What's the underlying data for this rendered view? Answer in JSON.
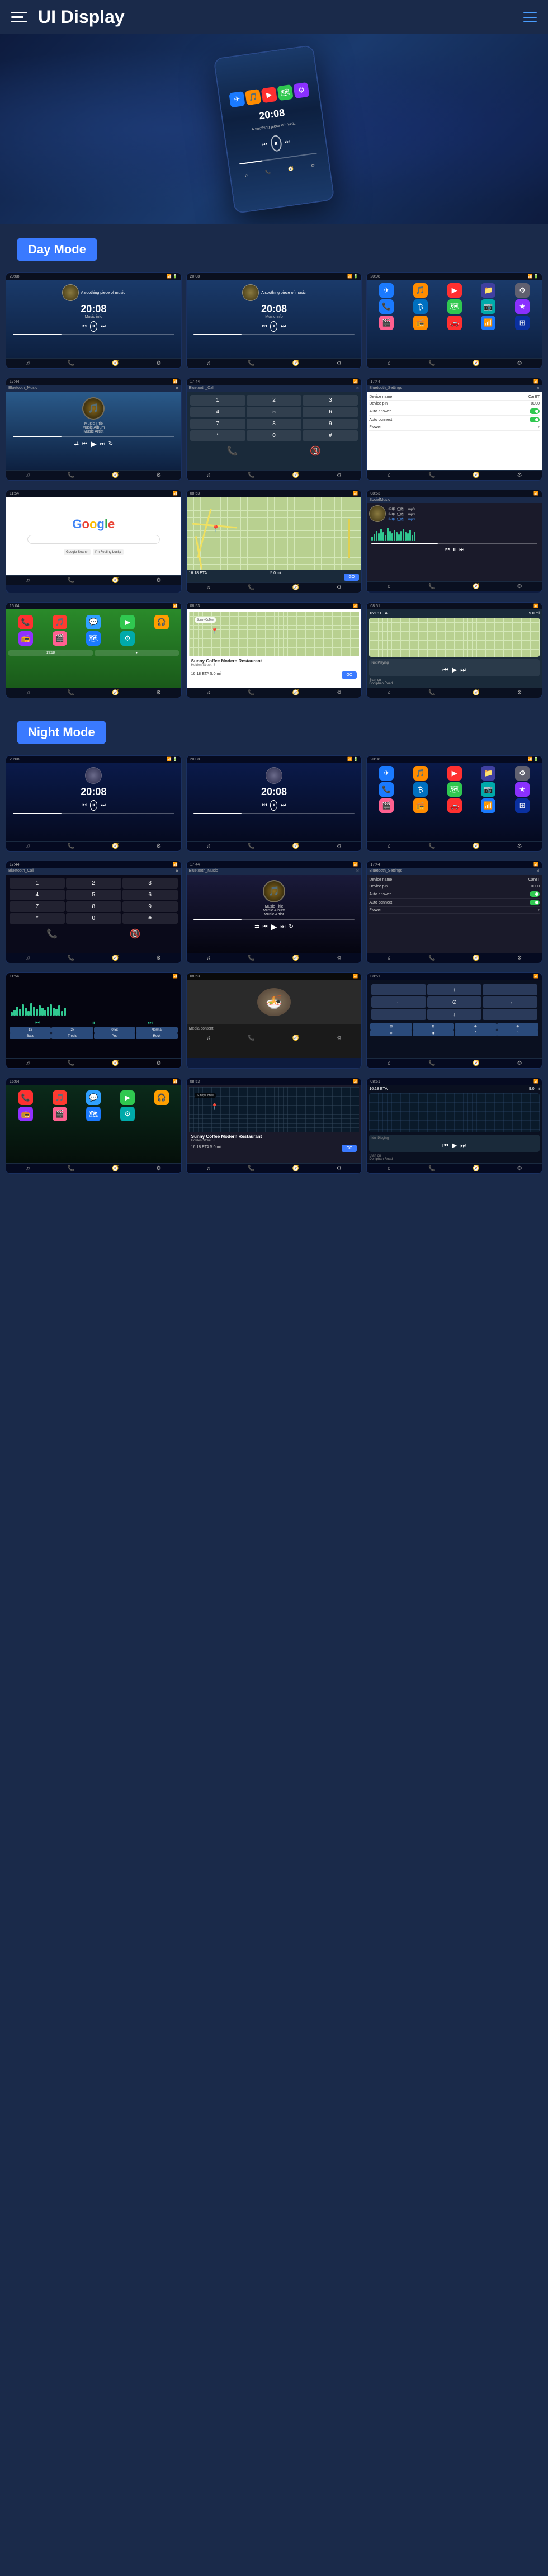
{
  "header": {
    "title": "UI Display",
    "menu_label": "Menu",
    "nav_label": "Navigation"
  },
  "sections": {
    "day_mode": "Day Mode",
    "night_mode": "Night Mode"
  },
  "screens": {
    "time": "20:08",
    "music_title": "Music Title",
    "music_album": "Music Album",
    "music_artist": "Music Artist",
    "bluetooth_music": "Bluetooth_Music",
    "bluetooth_call": "Bluetooth_Call",
    "bluetooth_settings": "Bluetooth_Settings",
    "device_name_label": "Device name",
    "device_name_value": "CarBT",
    "device_pin_label": "Device pin",
    "device_pin_value": "0000",
    "auto_answer_label": "Auto answer",
    "auto_connect_label": "Auto connect",
    "flower_label": "Flower",
    "google_text": "Google",
    "sunny_coffee": "Sunny Coffee Modern Restaurant",
    "sunny_address": "Holden Street, 8",
    "eta_label": "16:18 ETA",
    "eta_distance": "5.0 mi",
    "go_label": "GO",
    "not_playing": "Not Playing",
    "start_on": "Start on",
    "doniphan": "Doniphan Road",
    "social_music_label": "SocialMusic"
  },
  "app_icons": {
    "phone": "📞",
    "music": "🎵",
    "messages": "💬",
    "maps": "🗺",
    "camera": "📷",
    "settings": "⚙",
    "youtube": "▶",
    "weather": "☀",
    "apps": "⊞",
    "bt": "₿"
  },
  "numpad": [
    "1",
    "2",
    "3",
    "4",
    "5",
    "6",
    "7",
    "8",
    "9",
    "*",
    "0",
    "#"
  ],
  "wave_heights": [
    8,
    12,
    18,
    14,
    22,
    16,
    10,
    24,
    18,
    14,
    20,
    16,
    12,
    18,
    22,
    16,
    14,
    20,
    10,
    16
  ],
  "night_wave_heights": [
    6,
    10,
    16,
    12,
    20,
    14,
    8,
    22,
    16,
    12,
    18,
    14,
    10,
    16,
    20,
    14,
    12,
    18,
    8,
    14
  ]
}
